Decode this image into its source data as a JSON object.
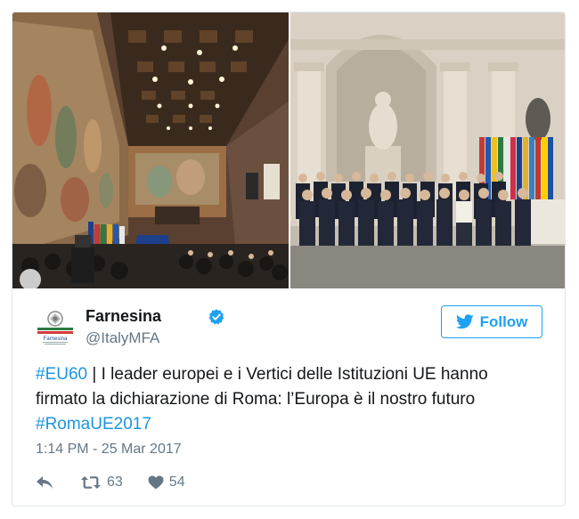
{
  "images": [
    {
      "icon": "photo-fresco-hall"
    },
    {
      "icon": "photo-group-leaders"
    }
  ],
  "author": {
    "name": "Farnesina",
    "handle": "@ItalyMFA",
    "avatar_icon": "farnesina-emblem-icon",
    "verified_icon": "verified-badge-icon"
  },
  "follow_label": "Follow",
  "tweet": {
    "hashtag_1": "#EU60",
    "sep": " | ",
    "body": "I leader europei e i Vertici delle Istituzioni UE hanno firmato la dichiarazione di Roma: l’Europa è il nostro futuro ",
    "hashtag_2": "#RomaUE2017"
  },
  "timestamp": "1:14 PM - 25 Mar 2017",
  "actions": {
    "retweet_count": "63",
    "like_count": "54"
  },
  "colors": {
    "link": "#1b95e0",
    "follow": "#1da1f2",
    "meta": "#657786",
    "verified": "#1da1f2"
  }
}
